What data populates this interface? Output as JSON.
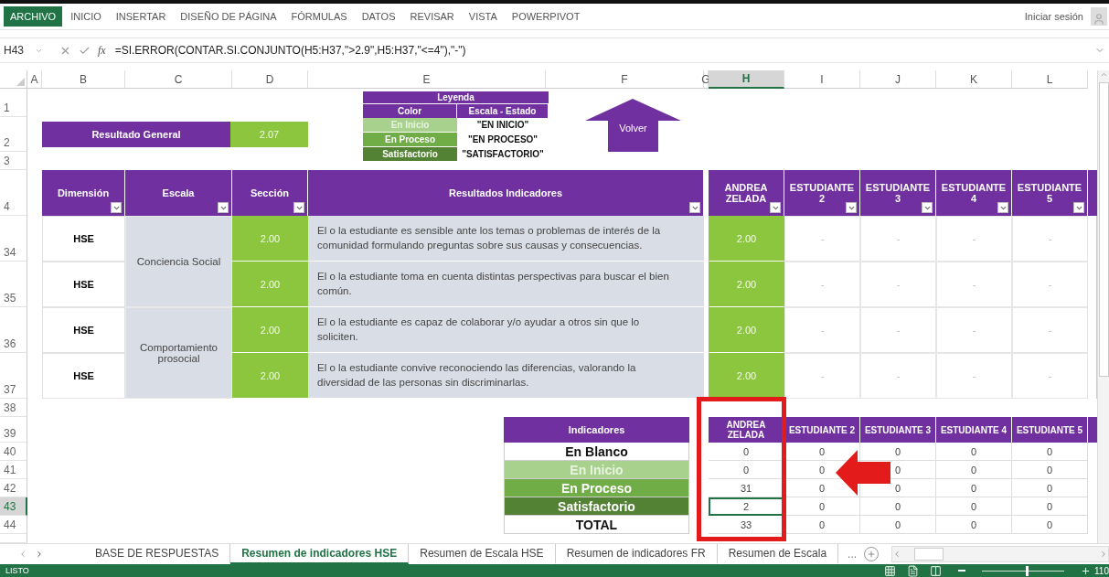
{
  "ribbon": {
    "tabs": [
      {
        "label": "ARCHIVO",
        "selected": true
      },
      {
        "label": "INICIO",
        "selected": false
      },
      {
        "label": "INSERTAR",
        "selected": false
      },
      {
        "label": "DISEÑO DE PÁGINA",
        "selected": false
      },
      {
        "label": "FÓRMULAS",
        "selected": false
      },
      {
        "label": "DATOS",
        "selected": false
      },
      {
        "label": "REVISAR",
        "selected": false
      },
      {
        "label": "VISTA",
        "selected": false
      },
      {
        "label": "POWERPIVOT",
        "selected": false
      }
    ],
    "sign_in": "Iniciar sesión"
  },
  "formula_bar": {
    "name_box": "H43",
    "fx": "fx",
    "formula": "=SI.ERROR(CONTAR.SI.CONJUNTO(H5:H37,\">2.9\",H5:H37,\"<=4\"),\"-\")"
  },
  "column_headers": [
    {
      "label": "A",
      "selected": false
    },
    {
      "label": "B",
      "selected": false
    },
    {
      "label": "C",
      "selected": false
    },
    {
      "label": "D",
      "selected": false
    },
    {
      "label": "E",
      "selected": false
    },
    {
      "label": "F",
      "selected": false
    },
    {
      "label": "G",
      "selected": false
    },
    {
      "label": "H",
      "selected": true
    },
    {
      "label": "I",
      "selected": false
    },
    {
      "label": "J",
      "selected": false
    },
    {
      "label": "K",
      "selected": false
    },
    {
      "label": "L",
      "selected": false
    }
  ],
  "row_headers": [
    {
      "label": "1",
      "selected": false
    },
    {
      "label": "2",
      "selected": false
    },
    {
      "label": "3",
      "selected": false
    },
    {
      "label": "4",
      "selected": false
    },
    {
      "label": "34",
      "selected": false
    },
    {
      "label": "35",
      "selected": false
    },
    {
      "label": "36",
      "selected": false
    },
    {
      "label": "37",
      "selected": false
    },
    {
      "label": "38",
      "selected": false
    },
    {
      "label": "39",
      "selected": false
    },
    {
      "label": "40",
      "selected": false
    },
    {
      "label": "41",
      "selected": false
    },
    {
      "label": "42",
      "selected": false
    },
    {
      "label": "43",
      "selected": true
    },
    {
      "label": "44",
      "selected": false
    }
  ],
  "general_result": {
    "label": "Resultado General",
    "value": "2.07"
  },
  "legend": {
    "title": "Leyenda",
    "headers": [
      "Color",
      "Escala - Estado"
    ],
    "rows": [
      {
        "color_label": "En Inicio",
        "state": "\"EN INICIO\"",
        "kind": "inicio"
      },
      {
        "color_label": "En Proceso",
        "state": "\"EN PROCESO\"",
        "kind": "proceso"
      },
      {
        "color_label": "Satisfactorio",
        "state": "\"SATISFACTORIO\"",
        "kind": "satisfactorio"
      }
    ]
  },
  "back_button": "Volver",
  "table": {
    "columns": [
      "Dimensión",
      "Escala",
      "Sección",
      "Resultados Indicadores"
    ],
    "students": [
      {
        "name": "ANDREA ZELADA",
        "graded": true
      },
      {
        "name": "ESTUDIANTE 2",
        "graded": false
      },
      {
        "name": "ESTUDIANTE 3",
        "graded": false
      },
      {
        "name": "ESTUDIANTE 4",
        "graded": false
      },
      {
        "name": "ESTUDIANTE 5",
        "graded": false
      }
    ],
    "scales": [
      {
        "label": "Conciencia Social",
        "items": [
          {
            "dimension": "HSE",
            "section": "2.00",
            "indicator": "El o la estudiante es sensible ante los temas o problemas de interés de la comunidad formulando preguntas sobre sus causas y consecuencias.",
            "values": [
              "2.00",
              "-",
              "-",
              "-",
              "-"
            ]
          },
          {
            "dimension": "HSE",
            "section": "2.00",
            "indicator": "El o la estudiante toma en cuenta distintas perspectivas para buscar el bien común.",
            "values": [
              "2.00",
              "-",
              "-",
              "-",
              "-"
            ]
          }
        ]
      },
      {
        "label": "Comportamiento prosocial",
        "items": [
          {
            "dimension": "HSE",
            "section": "2.00",
            "indicator": "El o la estudiante es capaz de colaborar y/o ayudar a otros sin que lo soliciten.",
            "values": [
              "2.00",
              "-",
              "-",
              "-",
              "-"
            ]
          },
          {
            "dimension": "HSE",
            "section": "2.00",
            "indicator": "El o la estudiante convive reconociendo las diferencias, valorando la diversidad de las personas sin discriminarlas.",
            "values": [
              "2.00",
              "-",
              "-",
              "-",
              "-"
            ]
          }
        ]
      }
    ]
  },
  "summary": {
    "title": "Indicadores",
    "students": [
      "ANDREA ZELADA",
      "ESTUDIANTE 2",
      "ESTUDIANTE 3",
      "ESTUDIANTE 4",
      "ESTUDIANTE 5"
    ],
    "rows": [
      {
        "label": "En Blanco",
        "kind": "blank",
        "selected": false,
        "values": [
          "0",
          "0",
          "0",
          "0",
          "0"
        ]
      },
      {
        "label": "En Inicio",
        "kind": "inicio",
        "selected": false,
        "values": [
          "0",
          "0",
          "0",
          "0",
          "0"
        ]
      },
      {
        "label": "En Proceso",
        "kind": "proceso",
        "selected": false,
        "values": [
          "31",
          "0",
          "0",
          "0",
          "0"
        ]
      },
      {
        "label": "Satisfactorio",
        "kind": "satisfactorio",
        "selected": true,
        "values": [
          "2",
          "0",
          "0",
          "0",
          "0"
        ]
      },
      {
        "label": "TOTAL",
        "kind": "total",
        "selected": false,
        "values": [
          "33",
          "0",
          "0",
          "0",
          "0"
        ]
      }
    ]
  },
  "sheet_tabs": [
    {
      "label": "BASE DE RESPUESTAS",
      "selected": false
    },
    {
      "label": "Resumen de indicadores HSE",
      "selected": true
    },
    {
      "label": "Resumen de Escala HSE",
      "selected": false
    },
    {
      "label": "Resumen de indicadores FR",
      "selected": false
    },
    {
      "label": "Resumen de Escala",
      "selected": false
    }
  ],
  "more_tabs": "...",
  "status_bar": {
    "status": "LISTO",
    "zoom": {
      "level": 0.53,
      "reading": "110"
    }
  }
}
